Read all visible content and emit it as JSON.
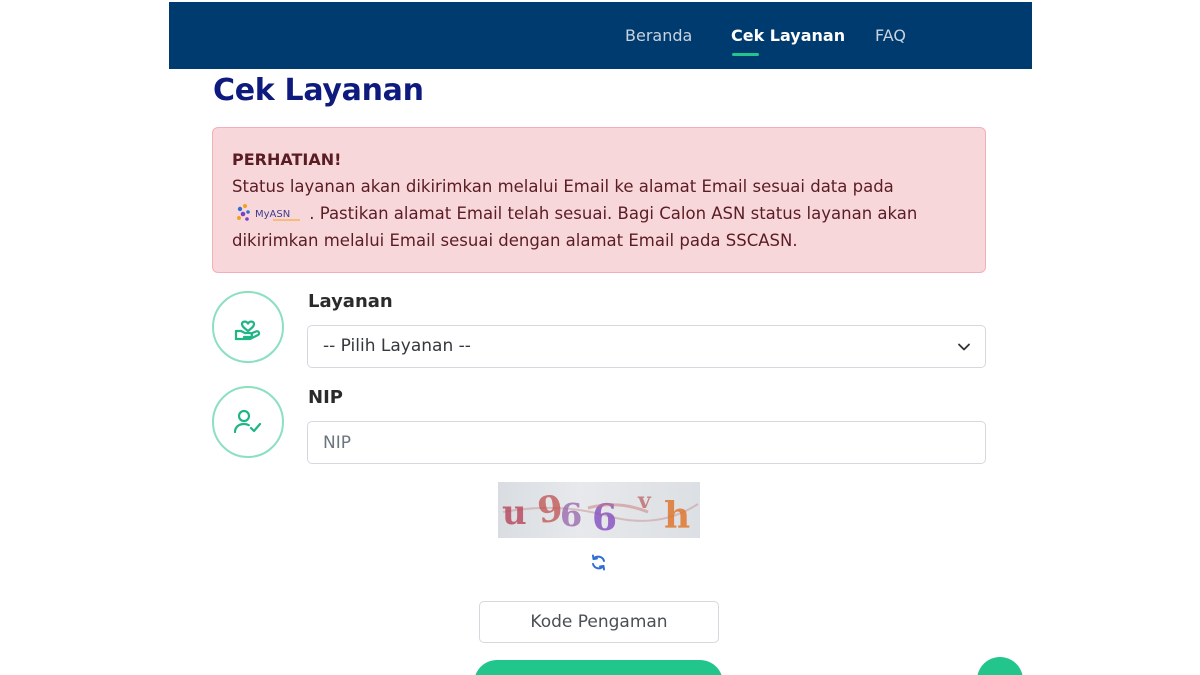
{
  "nav": {
    "items": [
      {
        "label": "Beranda",
        "active": false
      },
      {
        "label": "Cek Layanan",
        "active": true
      },
      {
        "label": "FAQ",
        "active": false
      }
    ]
  },
  "page": {
    "title": "Cek Layanan"
  },
  "alert": {
    "title": "PERHATIAN!",
    "text_before_logo": "Status layanan akan dikirimkan melalui Email ke alamat Email sesuai data pada",
    "logo_text": "MyASN",
    "text_after_logo": ". Pastikan alamat Email telah sesuai. Bagi Calon ASN status layanan akan dikirimkan melalui Email sesuai dengan alamat Email pada SSCASN."
  },
  "form": {
    "layanan_label": "Layanan",
    "layanan_selected": "-- Pilih Layanan --",
    "nip_label": "NIP",
    "nip_placeholder": "NIP",
    "captcha_text": "u96vh",
    "code_placeholder": "Kode Pengaman"
  },
  "colors": {
    "navbar": "#003b70",
    "accent_green": "#22c58b",
    "title_navy": "#0e1a7e",
    "alert_bg": "#f8d7da"
  },
  "icons": {
    "layanan": "hand-heart-icon",
    "nip": "user-check-icon",
    "refresh": "refresh-icon",
    "select": "chevron-down-icon"
  }
}
